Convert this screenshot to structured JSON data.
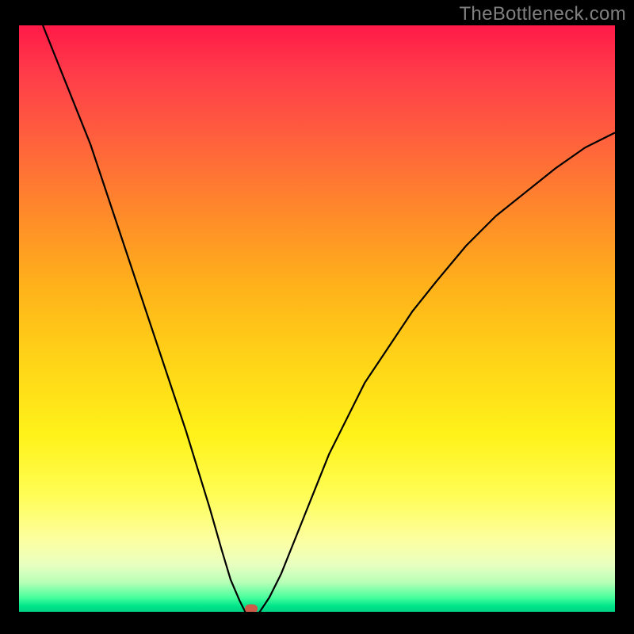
{
  "watermark": "TheBottleneck.com",
  "chart_data": {
    "type": "line",
    "title": "",
    "xlabel": "",
    "ylabel": "",
    "xlim": [
      0,
      100
    ],
    "ylim": [
      0,
      100
    ],
    "grid": false,
    "series": [
      {
        "name": "bottleneck-curve",
        "x": [
          4,
          6,
          8,
          10,
          12,
          14,
          16,
          18,
          20,
          22,
          24,
          26,
          28,
          30,
          32,
          34,
          35.5,
          37,
          38,
          39,
          40,
          42,
          44,
          46,
          48,
          50,
          52,
          55,
          58,
          62,
          66,
          70,
          75,
          80,
          85,
          90,
          95,
          100
        ],
        "values": [
          100,
          95,
          90,
          85,
          80,
          74,
          68,
          62,
          56,
          50,
          44,
          38,
          32,
          25.5,
          19,
          12,
          7,
          3.5,
          1.5,
          0.5,
          1,
          4,
          8,
          13,
          18,
          23,
          28,
          34,
          40,
          46,
          52,
          57,
          63,
          68,
          72,
          76,
          79.5,
          82
        ]
      }
    ],
    "marker": {
      "name": "optimal-point",
      "x": 39,
      "y": 0.5,
      "color": "#cc5b4a"
    },
    "background_gradient": {
      "stops": [
        {
          "pct": 0,
          "color": "#ff1a47"
        },
        {
          "pct": 8,
          "color": "#ff3b4a"
        },
        {
          "pct": 18,
          "color": "#ff5c3f"
        },
        {
          "pct": 32,
          "color": "#ff8a2a"
        },
        {
          "pct": 45,
          "color": "#ffb31a"
        },
        {
          "pct": 58,
          "color": "#ffd617"
        },
        {
          "pct": 70,
          "color": "#fff21a"
        },
        {
          "pct": 80,
          "color": "#fffd55"
        },
        {
          "pct": 88,
          "color": "#fcffa2"
        },
        {
          "pct": 92,
          "color": "#e8ffc0"
        },
        {
          "pct": 95,
          "color": "#b7ffb7"
        },
        {
          "pct": 97.5,
          "color": "#4cff9e"
        },
        {
          "pct": 99,
          "color": "#00e68a"
        },
        {
          "pct": 100,
          "color": "#00d084"
        }
      ]
    }
  }
}
